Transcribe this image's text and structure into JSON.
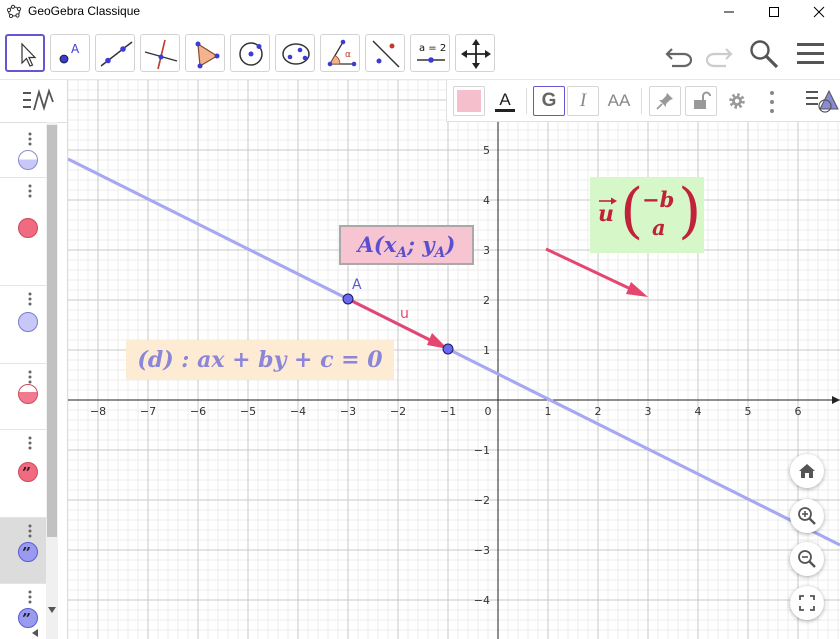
{
  "window": {
    "title": "GeoGebra Classique",
    "minimize_glyph": "—",
    "maximize_glyph": "☐",
    "close_glyph": "✕"
  },
  "toolbar": {
    "tools": [
      {
        "name": "move-tool",
        "icon": "cursor-arrow-icon",
        "selected": true
      },
      {
        "name": "point-tool",
        "icon": "point-icon"
      },
      {
        "name": "line-tool",
        "icon": "line-icon"
      },
      {
        "name": "perpendicular-line-tool",
        "icon": "perpendicular-icon"
      },
      {
        "name": "polygon-tool",
        "icon": "polygon-icon"
      },
      {
        "name": "circle-tool",
        "icon": "circle-icon"
      },
      {
        "name": "conic-tool",
        "icon": "ellipse-icon"
      },
      {
        "name": "angle-tool",
        "icon": "angle-icon"
      },
      {
        "name": "reflect-tool",
        "icon": "reflect-icon"
      },
      {
        "name": "slider-tool",
        "icon": "slider-icon",
        "label": "a = 2"
      },
      {
        "name": "move-graphics-tool",
        "icon": "move-arrows-icon"
      }
    ],
    "right_icons": [
      "undo-icon",
      "redo-icon",
      "search-icon",
      "menu-icon"
    ]
  },
  "style_bar": {
    "text_color_label": "A",
    "bold_label": "G",
    "italic_label": "I",
    "size_label": "AA",
    "fill_color": "#f5c0cc"
  },
  "axes": {
    "x_ticks": [
      "−8",
      "−7",
      "−6",
      "−5",
      "−4",
      "−3",
      "−2",
      "−1",
      "0",
      "1",
      "2",
      "3",
      "4",
      "5",
      "6"
    ],
    "y_ticks_pos": [
      "5",
      "4",
      "3",
      "2",
      "1"
    ],
    "y_ticks_neg": [
      "−1",
      "−2",
      "−3",
      "−4"
    ]
  },
  "objects": {
    "point_a_label": "A",
    "vector_label": "u"
  },
  "formulas": {
    "point_a": {
      "text": "A(x",
      "sub1": "A",
      "sep": "; y",
      "sub2": "A",
      "close": ")",
      "bg": "#f7c5d1",
      "color": "#5a4fd0"
    },
    "line_eq": {
      "text": "(d) : ax + by + c = 0",
      "bg": "#fdebd3",
      "color": "#8b86d8"
    },
    "vector_u": {
      "name": "u",
      "top": "−b",
      "bottom": "a",
      "bg": "#d6f7c8",
      "color": "#c2213a"
    }
  },
  "colors": {
    "line": "#a7a8f0",
    "vector": "#e5466f",
    "point_fill": "#6a6af0",
    "accent": "#6557d2"
  },
  "floating_buttons": [
    "home-icon",
    "zoom-in-icon",
    "zoom-out-icon",
    "fullscreen-icon"
  ]
}
